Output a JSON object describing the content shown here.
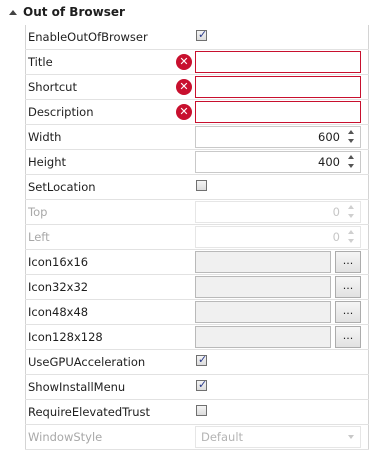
{
  "section": {
    "title": "Out of Browser"
  },
  "rows": {
    "enable": {
      "label": "EnableOutOfBrowser",
      "checked": true
    },
    "title": {
      "label": "Title",
      "value": ""
    },
    "shortcut": {
      "label": "Shortcut",
      "value": ""
    },
    "description": {
      "label": "Description",
      "value": ""
    },
    "width": {
      "label": "Width",
      "value": "600"
    },
    "height": {
      "label": "Height",
      "value": "400"
    },
    "setlocation": {
      "label": "SetLocation",
      "checked": false
    },
    "top": {
      "label": "Top",
      "value": "0"
    },
    "left": {
      "label": "Left",
      "value": "0"
    },
    "icon16": {
      "label": "Icon16x16",
      "value": "",
      "button": "..."
    },
    "icon32": {
      "label": "Icon32x32",
      "value": "",
      "button": "..."
    },
    "icon48": {
      "label": "Icon48x48",
      "value": "",
      "button": "..."
    },
    "icon128": {
      "label": "Icon128x128",
      "value": "",
      "button": "..."
    },
    "gpu": {
      "label": "UseGPUAcceleration",
      "checked": true
    },
    "installmenu": {
      "label": "ShowInstallMenu",
      "checked": true
    },
    "elevated": {
      "label": "RequireElevatedTrust",
      "checked": false
    },
    "windowstyle": {
      "label": "WindowStyle",
      "value": "Default"
    }
  },
  "icons": {
    "error": "error-icon",
    "collapse": "collapse-triangle-icon",
    "spinner": "spinner-icon",
    "dropdown": "chevron-down-icon"
  },
  "colors": {
    "error": "#c8102e",
    "disabled_text": "#a8a8a8",
    "grid_line": "#e2e2e2"
  }
}
